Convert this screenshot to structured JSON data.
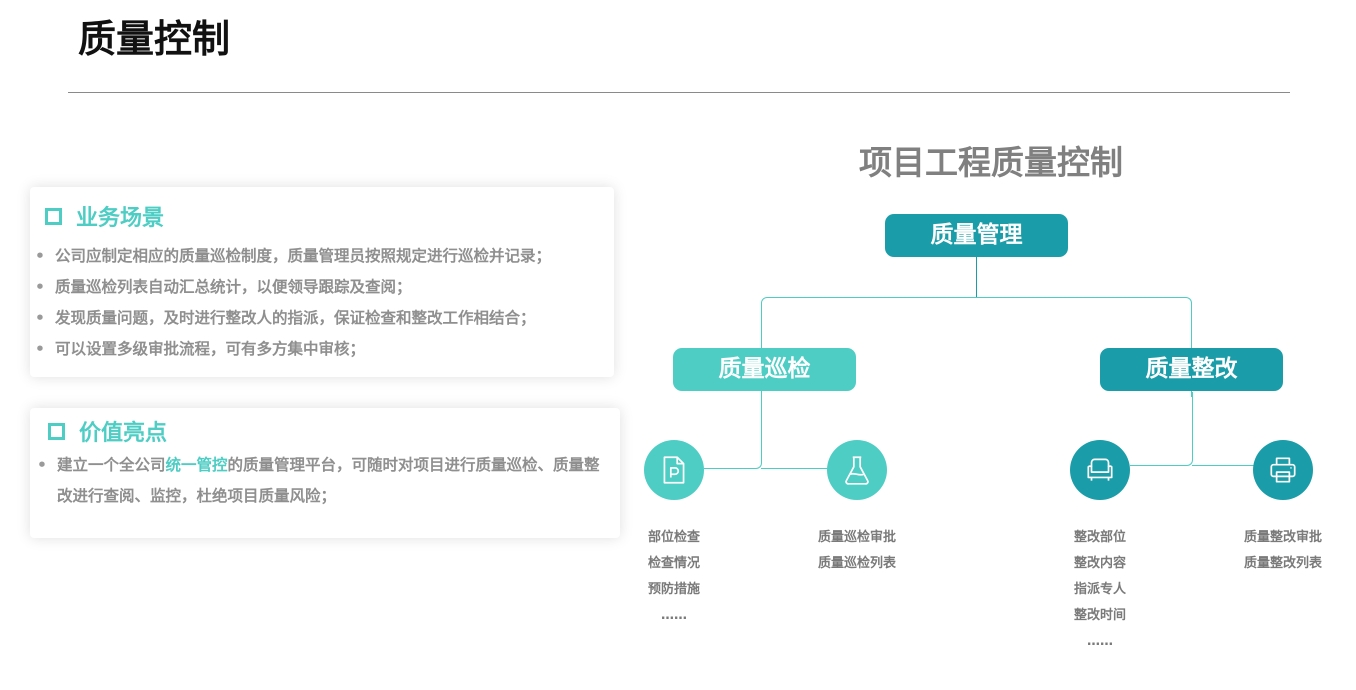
{
  "page": {
    "title": "质量控制"
  },
  "business": {
    "title": "业务场景",
    "items": [
      "公司应制定相应的质量巡检制度，质量管理员按照规定进行巡检并记录；",
      "质量巡检列表自动汇总统计，以便领导跟踪及查阅；",
      "发现质量问题，及时进行整改人的指派，保证检查和整改工作相结合；",
      "可以设置多级审批流程，可有多方集中审核；"
    ]
  },
  "value": {
    "title": "价值亮点",
    "item_prefix": "建立一个全公司",
    "item_highlight": "统一管控",
    "item_suffix": "的质量管理平台，可随时对项目进行质量巡检、质量整改进行查阅、监控，杜绝项目质量风险；"
  },
  "org": {
    "title": "项目工程质量控制",
    "root": "质量管理",
    "left": "质量巡检",
    "right": "质量整改",
    "leaves": [
      {
        "icon": "document-p-icon",
        "labels": [
          "部位检查",
          "检查情况",
          "预防措施",
          "……"
        ]
      },
      {
        "icon": "flask-icon",
        "labels": [
          "质量巡检审批",
          "质量巡检列表"
        ]
      },
      {
        "icon": "sofa-icon",
        "labels": [
          "整改部位",
          "整改内容",
          "指派专人",
          "整改时间",
          "……"
        ]
      },
      {
        "icon": "printer-icon",
        "labels": [
          "质量整改审批",
          "质量整改列表"
        ]
      }
    ]
  },
  "colors": {
    "teal_light": "#4ecdc4",
    "teal_dark": "#1a9da8",
    "text_gray": "#8f8f8f"
  }
}
